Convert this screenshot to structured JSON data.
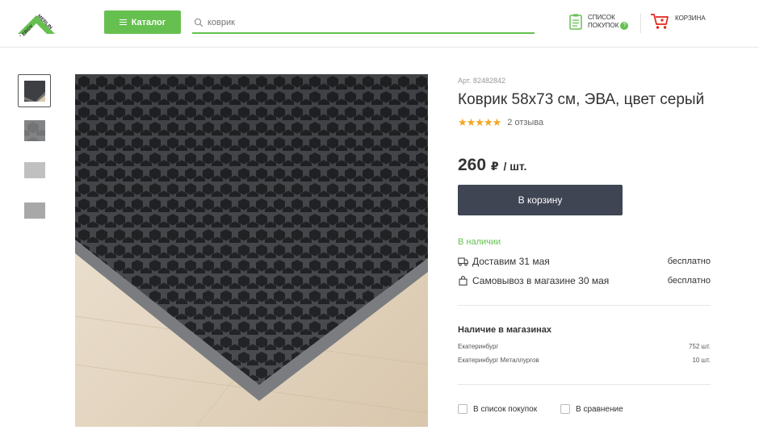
{
  "header": {
    "logo_text": "LEROY MERLIN",
    "catalog_label": "Каталог",
    "search_placeholder": "коврик",
    "shopping_list_line1": "СПИСОК",
    "shopping_list_line2": "ПОКУПОК",
    "cart_label": "КОРЗИНА",
    "brand_color": "#66c050"
  },
  "gallery": {
    "thumbnails": [
      "product-photo-1",
      "product-photo-2",
      "product-photo-3",
      "product-photo-4"
    ],
    "active_index": 0
  },
  "product": {
    "article": "Арт. 82482842",
    "title": "Коврик 58x73 см, ЭВА, цвет серый",
    "stars": "★★★★★",
    "rating": 5,
    "reviews": "2 отзыва",
    "price": "260",
    "currency": "₽",
    "unit": "/ шт.",
    "buy_label": "В корзину"
  },
  "availability": {
    "status": "В наличии",
    "delivery_label": "Доставим 31 мая",
    "delivery_price": "бесплатно",
    "pickup_label": "Самовывоз в магазине 30 мая",
    "pickup_price": "бесплатно"
  },
  "stores": {
    "title": "Наличие в магазинах",
    "items": [
      {
        "name": "Екатеринбург",
        "qty": "752 шт."
      },
      {
        "name": "Екатеринбург Металлургов",
        "qty": "10 шт."
      }
    ]
  },
  "actions": {
    "add_to_list": "В список покупок",
    "compare": "В сравнение"
  }
}
